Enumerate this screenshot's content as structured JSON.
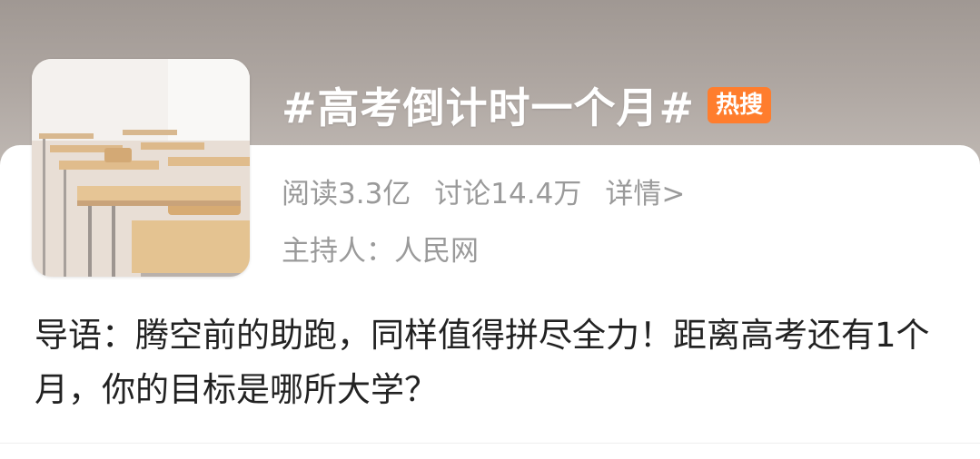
{
  "topic": {
    "title": "#高考倒计时一个月#",
    "badge": "热搜",
    "stats": {
      "reads": "阅读3.3亿",
      "discussions": "讨论14.4万",
      "detail": "详情>"
    },
    "host": "主持人：人民网",
    "intro": "导语：腾空前的助跑，同样值得拼尽全力！距离高考还有1个月，你的目标是哪所大学？"
  },
  "colors": {
    "badge": "#ff7d2d",
    "secondary_text": "#9a9a9a",
    "body_text": "#222222"
  }
}
